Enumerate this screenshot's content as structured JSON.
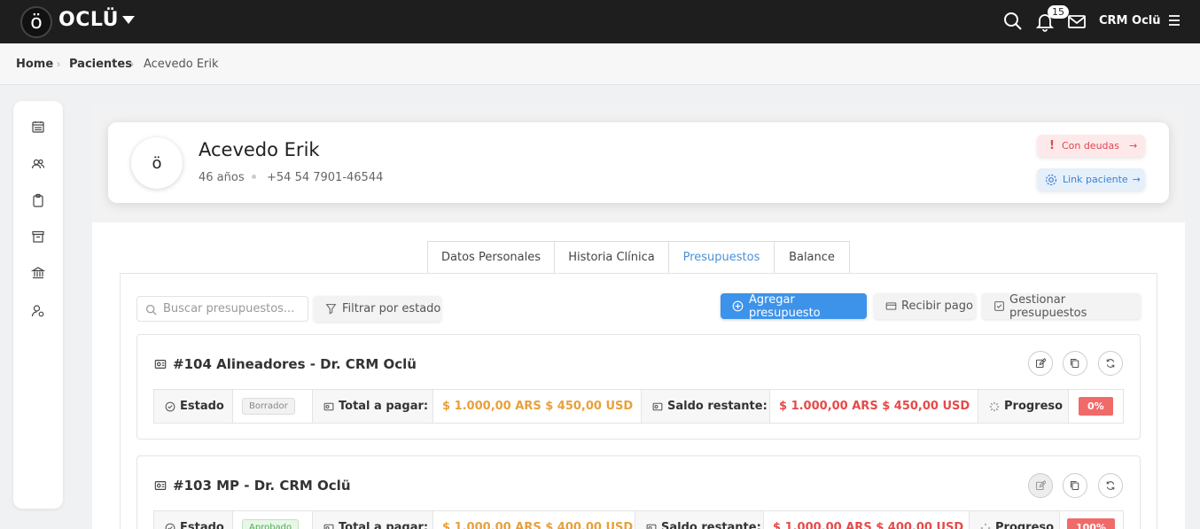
{
  "topbar": {
    "logo_glyph": "ö",
    "brand": "OCLÜ",
    "notifications_count": "15",
    "user": "CRM Oclü"
  },
  "breadcrumb": {
    "items": [
      "Home",
      "Pacientes",
      "Acevedo Erik"
    ]
  },
  "sidebar": {
    "icons": [
      "calendar-icon",
      "users-icon",
      "clipboard-icon",
      "archive-icon",
      "bank-icon",
      "user-settings-icon"
    ]
  },
  "patient": {
    "avatar_glyph": "ö",
    "name": "Acevedo Erik",
    "age": "46 años",
    "phone": "+54 54 7901-46544",
    "debt_label": "Con deudas",
    "link_label": "Link paciente"
  },
  "tabs": [
    "Datos Personales",
    "Historia Clínica",
    "Presupuestos",
    "Balance"
  ],
  "active_tab": "Presupuestos",
  "toolbar": {
    "search_placeholder": "Buscar presupuestos...",
    "filter_label": "Filtrar por estado",
    "add_label": "Agregar presupuesto",
    "pay_label": "Recibir pago",
    "manage_label": "Gestionar presupuestos"
  },
  "labels": {
    "estado": "Estado",
    "total": "Total a pagar:",
    "saldo": "Saldo restante:",
    "progreso": "Progreso"
  },
  "budgets": [
    {
      "title": "#104 Alineadores - Dr. CRM Oclü",
      "status": "Borrador",
      "total": "$ 1.000,00 ARS $ 450,00 USD",
      "remaining": "$ 1.000,00 ARS $ 450,00 USD",
      "progress": "0%"
    },
    {
      "title": "#103 MP - Dr. CRM Oclü",
      "status": "Aprobado",
      "total": "$ 1.000,00 ARS $ 400,00 USD",
      "remaining": "$ 1.000,00 ARS $ 400,00 USD",
      "progress": "100%"
    }
  ],
  "colors": {
    "topbar": "#1e1e1e",
    "accent": "#3d93ea",
    "orange_amount": "#e8a03a",
    "red_amount": "#e64a4a",
    "debt": "#e0454f"
  }
}
